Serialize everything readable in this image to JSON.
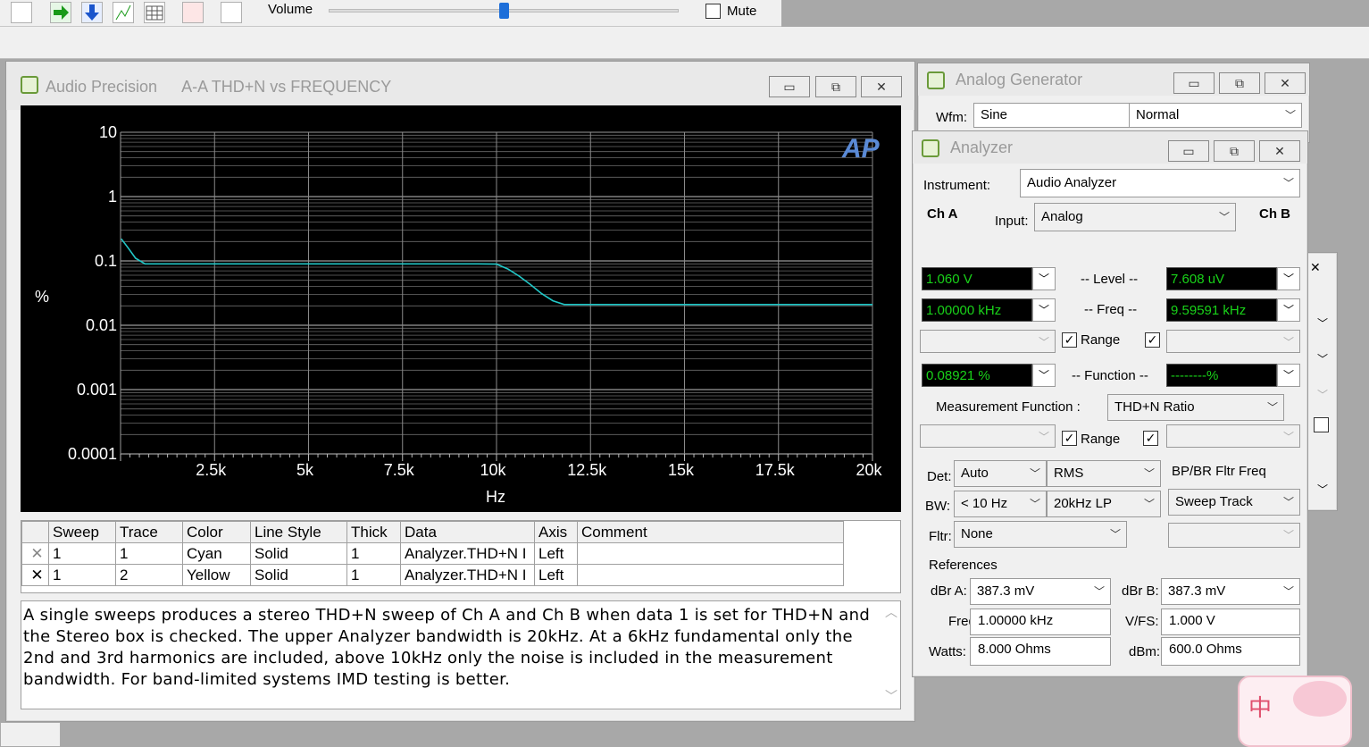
{
  "toolbar": {
    "volume_label": "Volume",
    "mute_label": "Mute",
    "volume_level": 0.5
  },
  "graph_window": {
    "app_name": "Audio Precision",
    "graph_title": "A-A THD+N vs FREQUENCY",
    "logo_text": "AP",
    "description": "A single sweeps produces a stereo THD+N sweep of Ch A and Ch B when data 1 is set for THD+N and the Stereo box is checked.  The upper Analyzer bandwidth is 20kHz.  At a 6kHz fundamental only the 2nd and 3rd harmonics are included, above 10kHz only the noise is included in the measurement bandwidth.  For band-limited systems IMD testing is better.",
    "table": {
      "headers": [
        "Sweep",
        "Trace",
        "Color",
        "Line Style",
        "Thick",
        "Data",
        "Axis",
        "Comment"
      ],
      "rows": [
        {
          "check": "✕",
          "sweep": "1",
          "trace": "1",
          "color": "Cyan",
          "style": "Solid",
          "thick": "1",
          "data": "Analyzer.THD+N I",
          "axis": "Left",
          "comment": ""
        },
        {
          "check": "✕",
          "sweep": "1",
          "trace": "2",
          "color": "Yellow",
          "style": "Solid",
          "thick": "1",
          "data": "Analyzer.THD+N I",
          "axis": "Left",
          "comment": ""
        }
      ]
    }
  },
  "chart_data": {
    "type": "line",
    "title": "",
    "xlabel": "Hz",
    "ylabel": "%",
    "xlim": [
      0,
      20000
    ],
    "ylim": [
      0.0001,
      10
    ],
    "log_y": true,
    "grid": true,
    "x_tick_labels": [
      "2.5k",
      "5k",
      "7.5k",
      "10k",
      "12.5k",
      "15k",
      "17.5k",
      "20k"
    ],
    "x_ticks": [
      2500,
      5000,
      7500,
      10000,
      12500,
      15000,
      17500,
      20000
    ],
    "y_tick_labels": [
      "10",
      "1",
      "0.1",
      "0.01",
      "0.001",
      "0.0001"
    ],
    "y_ticks": [
      10,
      1,
      0.1,
      0.01,
      0.001,
      0.0001
    ],
    "series": [
      {
        "color": "#22c8c8",
        "x": [
          20,
          200,
          400,
          650,
          1000,
          2000,
          4000,
          6000,
          8000,
          9500,
          10000,
          10300,
          10600,
          10900,
          11200,
          11500,
          11800,
          12000,
          14000,
          16000,
          18000,
          20000
        ],
        "y": [
          0.22,
          0.16,
          0.11,
          0.09,
          0.09,
          0.09,
          0.09,
          0.09,
          0.09,
          0.09,
          0.089,
          0.075,
          0.058,
          0.043,
          0.031,
          0.024,
          0.021,
          0.021,
          0.021,
          0.021,
          0.021,
          0.021
        ]
      }
    ]
  },
  "generator": {
    "title": "Analog Generator",
    "wfm_label": "Wfm:",
    "wfm_value": "Sine",
    "mode_value": "Normal"
  },
  "analyzer": {
    "title": "Analyzer",
    "instrument_label": "Instrument:",
    "instrument_value": "Audio Analyzer",
    "cha_label": "Ch A",
    "chb_label": "Ch B",
    "input_label": "Input:",
    "input_value": "Analog",
    "level_label": "-- Level --",
    "level_a": "1.060   V",
    "level_b": "7.608   uV",
    "freq_label": "-- Freq --",
    "freq_a": "1.00000 kHz",
    "freq_b": "9.59591 kHz",
    "range_label": "Range",
    "function_label": "-- Function --",
    "function_a": "0.08921  %",
    "function_b": "--------%",
    "meas_func_label": "Measurement Function :",
    "meas_func_value": "THD+N Ratio",
    "det_label": "Det:",
    "det_value": "Auto",
    "det_mode": "RMS",
    "bpbr_label": "BP/BR Fltr Freq",
    "bw_label": "BW:",
    "bw_low": "< 10 Hz",
    "bw_high": "20kHz LP",
    "bpbr_value": "Sweep Track",
    "fltr_label": "Fltr:",
    "fltr_value": "None",
    "references_label": "References",
    "dbra_label": "dBr A:",
    "dbra_value": "387.3   mV",
    "dbrb_label": "dBr B:",
    "dbrb_value": "387.3   mV",
    "freq_ref_label": "Freq:",
    "freq_ref_value": "1.00000 kHz",
    "vfs_label": "V/FS:",
    "vfs_value": "1.000    V",
    "watts_label": "Watts:",
    "watts_value": "8.000    Ohms",
    "dbm_label": "dBm:",
    "dbm_value": "600.0    Ohms"
  },
  "widget": {
    "glyph": "中"
  },
  "colors": {
    "trace1": "#22c8c8",
    "display_text": "#19d219",
    "graph_bg": "#000000"
  }
}
